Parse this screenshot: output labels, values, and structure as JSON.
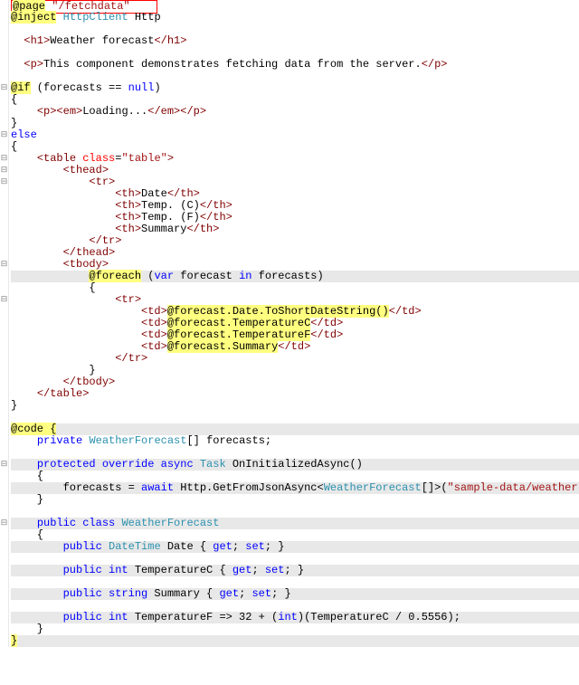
{
  "lines": [
    {
      "html": "<span class='redbox'><span class='dir'>@page</span> <span class='str'>\"/fetchdata\"</span>&nbsp;&nbsp;&nbsp;&nbsp;</span>"
    },
    {
      "html": "<span class='dir'>@inject</span> <span class='typ'>HttpClient</span> Http"
    },
    {
      "html": "&nbsp;"
    },
    {
      "html": "<span class='tag'>&lt;h1&gt;</span>Weather forecast<span class='tag'>&lt;/h1&gt;</span>",
      "indent": 1
    },
    {
      "html": "&nbsp;"
    },
    {
      "html": "<span class='tag'>&lt;p&gt;</span>This component demonstrates fetching data from the server.<span class='tag'>&lt;/p&gt;</span>",
      "indent": 1
    },
    {
      "html": "&nbsp;"
    },
    {
      "html": "<span class='dir'>@if</span> (forecasts == <span class='kw'>null</span>)",
      "fold": "-"
    },
    {
      "html": "{"
    },
    {
      "html": "    <span class='tag'>&lt;p&gt;&lt;em&gt;</span>Loading...<span class='tag'>&lt;/em&gt;&lt;/p&gt;</span>"
    },
    {
      "html": "}"
    },
    {
      "html": "<span class='kw'>else</span>",
      "fold": "-"
    },
    {
      "html": "{"
    },
    {
      "html": "    <span class='tag'>&lt;table</span> <span class='attr'>class</span>=<span class='str'>\"table\"</span><span class='tag'>&gt;</span>",
      "fold": "-"
    },
    {
      "html": "        <span class='tag'>&lt;thead&gt;</span>",
      "fold": "-"
    },
    {
      "html": "            <span class='tag'>&lt;tr&gt;</span>",
      "fold": "-"
    },
    {
      "html": "                <span class='tag'>&lt;th&gt;</span>Date<span class='tag'>&lt;/th&gt;</span>"
    },
    {
      "html": "                <span class='tag'>&lt;th&gt;</span>Temp. (C)<span class='tag'>&lt;/th&gt;</span>"
    },
    {
      "html": "                <span class='tag'>&lt;th&gt;</span>Temp. (F)<span class='tag'>&lt;/th&gt;</span>"
    },
    {
      "html": "                <span class='tag'>&lt;th&gt;</span>Summary<span class='tag'>&lt;/th&gt;</span>"
    },
    {
      "html": "            <span class='tag'>&lt;/tr&gt;</span>"
    },
    {
      "html": "        <span class='tag'>&lt;/thead&gt;</span>"
    },
    {
      "html": "        <span class='tag'>&lt;tbody&gt;</span>",
      "fold": "-"
    },
    {
      "html": "            <span class='dir'>@foreach</span> (<span class='kw'>var</span> forecast <span class='kw'>in</span> forecast<span class='plain'>s</span>)",
      "hl": true
    },
    {
      "html": "            {"
    },
    {
      "html": "                <span class='tag'>&lt;tr&gt;</span>",
      "fold": "-"
    },
    {
      "html": "                    <span class='tag'>&lt;td&gt;</span><span class='dir'>@forecast.Date.ToShortDateString()</span><span class='tag'>&lt;/td&gt;</span>"
    },
    {
      "html": "                    <span class='tag'>&lt;td&gt;</span><span class='dir'>@forecast.TemperatureC</span><span class='tag'>&lt;/td&gt;</span>"
    },
    {
      "html": "                    <span class='tag'>&lt;td&gt;</span><span class='dir'>@forecast.TemperatureF</span><span class='tag'>&lt;/td&gt;</span>"
    },
    {
      "html": "                    <span class='tag'>&lt;td&gt;</span><span class='dir'>@forecast.Summary</span><span class='tag'>&lt;/td&gt;</span>"
    },
    {
      "html": "                <span class='tag'>&lt;/tr&gt;</span>"
    },
    {
      "html": "            }"
    },
    {
      "html": "        <span class='tag'>&lt;/tbody&gt;</span>"
    },
    {
      "html": "    <span class='tag'>&lt;/table&gt;</span>"
    },
    {
      "html": "}"
    },
    {
      "html": "&nbsp;"
    },
    {
      "html": "<span class='dir'>@code {</span>",
      "hl": true
    },
    {
      "html": "    <span class='kw'>private</span> <span class='typ'>WeatherForecast</span>[] forecast<span class='plain'>s</span>;"
    },
    {
      "html": "&nbsp;"
    },
    {
      "html": "    <span class='kw'>protected override async</span> <span class='typ'>Task</span> OnInitializedAsync()",
      "fold": "-",
      "hl": true
    },
    {
      "html": "    {"
    },
    {
      "html": "        forecasts = <span class='kw'>await</span> Http.GetFromJsonAsync&lt;<span class='typ'>WeatherForecast</span>[]&gt;(<span class='str'>\"sample-data/weather.json\"</span>);",
      "hl": true
    },
    {
      "html": "    }"
    },
    {
      "html": "&nbsp;"
    },
    {
      "html": "    <span class='kw'>public class</span> <span class='typ'>WeatherForecast</span>",
      "fold": "-",
      "hl": true
    },
    {
      "html": "    {"
    },
    {
      "html": "        <span class='kw'>public</span> <span class='typ'>DateTime</span> Date { <span class='kw'>get</span>; <span class='kw'>set</span>; }",
      "hl": true
    },
    {
      "html": "&nbsp;"
    },
    {
      "html": "        <span class='kw'>public int</span> TemperatureC { <span class='kw'>get</span>; <span class='kw'>set</span>; }",
      "hl": true
    },
    {
      "html": "&nbsp;"
    },
    {
      "html": "        <span class='kw'>public string</span> Summary { <span class='kw'>get</span>; <span class='kw'>set</span>; }",
      "hl": true
    },
    {
      "html": "&nbsp;"
    },
    {
      "html": "        <span class='kw'>public int</span> TemperatureF =&gt; 32 + (<span class='kw'>int</span>)(TemperatureC / 0.5556);",
      "hl": true
    },
    {
      "html": "    }"
    },
    {
      "html": "<span class='dir'>}</span>",
      "hl": true
    }
  ]
}
